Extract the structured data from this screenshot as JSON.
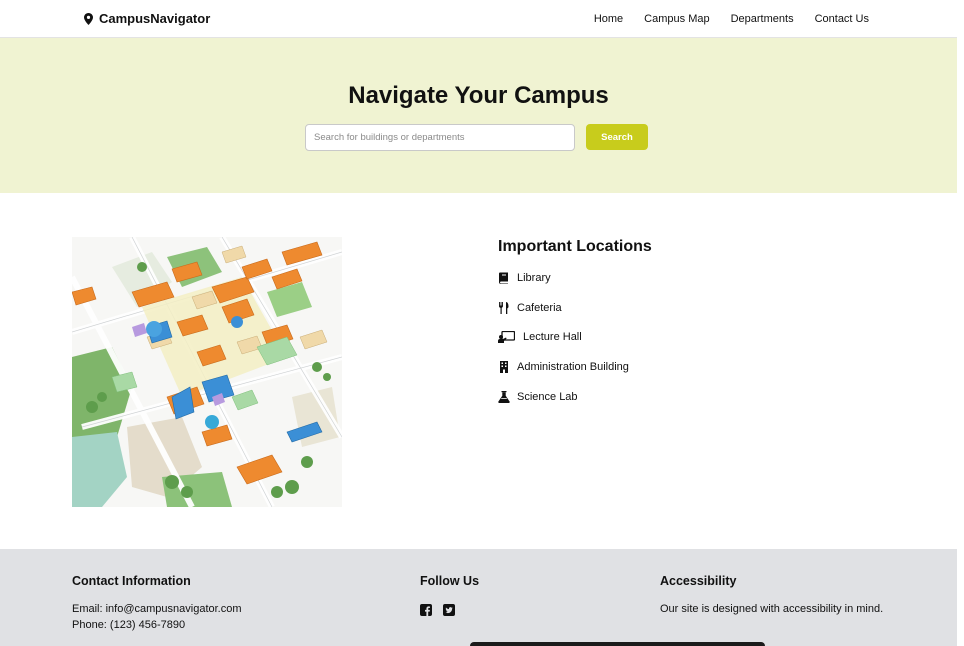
{
  "nav": {
    "brand": "CampusNavigator",
    "brand_icon": "map-pin-icon",
    "links": [
      "Home",
      "Campus Map",
      "Departments",
      "Contact Us"
    ]
  },
  "hero": {
    "title": "Navigate Your Campus",
    "search_placeholder": "Search for buildings or departments",
    "search_value": "",
    "search_button": "Search",
    "colors": {
      "background": "#f0f3d2",
      "button": "#c8cc1c"
    }
  },
  "locations": {
    "title": "Important Locations",
    "items": [
      {
        "label": "Library",
        "icon": "book-icon"
      },
      {
        "label": "Cafeteria",
        "icon": "utensils-icon"
      },
      {
        "label": "Lecture Hall",
        "icon": "chalkboard-teacher-icon"
      },
      {
        "label": "Administration Building",
        "icon": "building-icon"
      },
      {
        "label": "Science Lab",
        "icon": "flask-icon"
      }
    ]
  },
  "footer": {
    "contact": {
      "heading": "Contact Information",
      "email": "Email: info@campusnavigator.com",
      "phone": "Phone: (123) 456-7890"
    },
    "social": {
      "heading": "Follow Us",
      "icons": [
        "facebook-icon",
        "twitter-icon"
      ]
    },
    "accessibility": {
      "heading": "Accessibility",
      "text": "Our site is designed with accessibility in mind."
    }
  }
}
